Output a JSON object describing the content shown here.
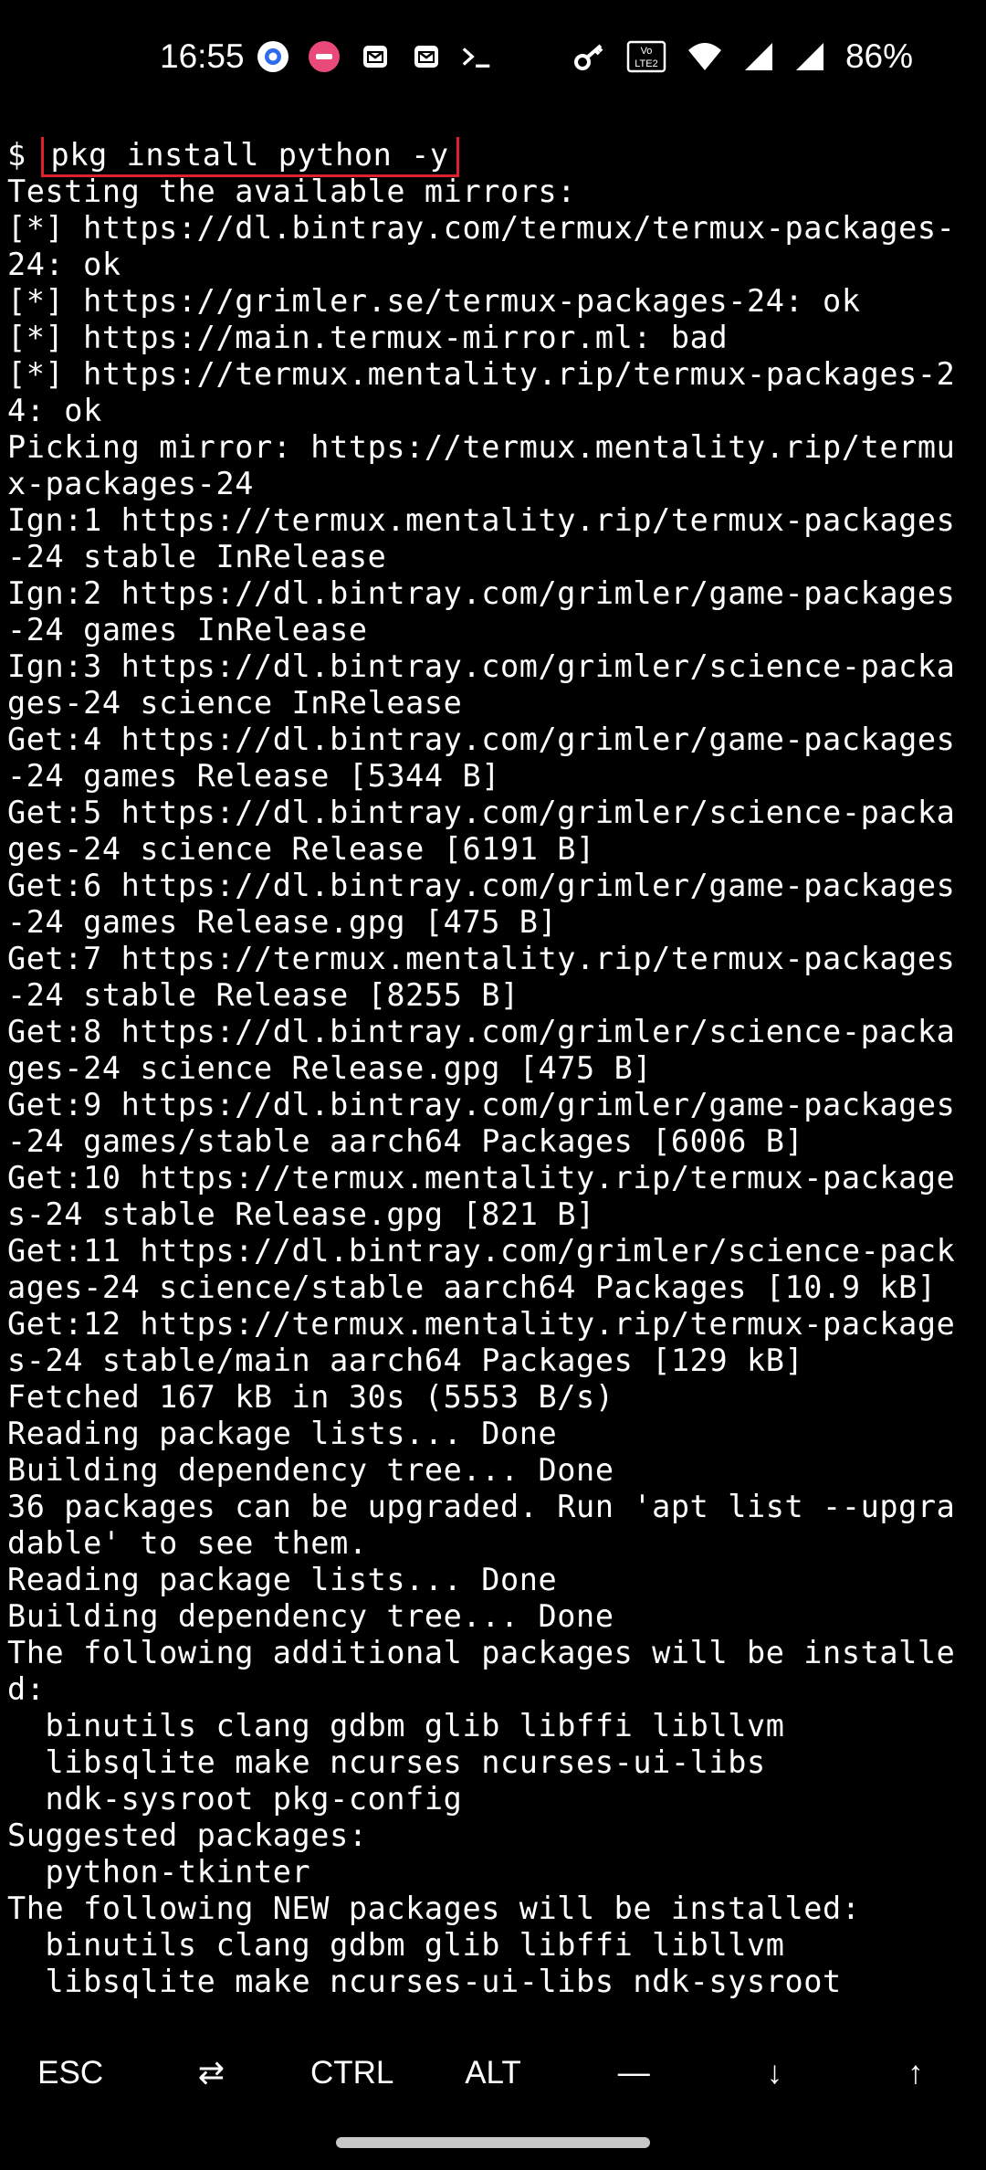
{
  "status_bar": {
    "time": "16:55",
    "battery": "86%",
    "notification_icons": [
      "signal-app-icon",
      "pink-app-icon",
      "mail-icon",
      "mail-icon",
      "terminal-icon"
    ],
    "system_icons": [
      "vpn-key-icon",
      "volte-icon",
      "wifi-icon",
      "cell-signal-icon",
      "cell-signal-icon"
    ],
    "volte_label": "Vo LTE2"
  },
  "terminal": {
    "prompt": "$ ",
    "command": "pkg install python -y",
    "lines": [
      "Testing the available mirrors:",
      "[*] https://dl.bintray.com/termux/termux-packages-",
      "24: ok",
      "[*] https://grimler.se/termux-packages-24: ok",
      "[*] https://main.termux-mirror.ml: bad",
      "[*] https://termux.mentality.rip/termux-packages-2",
      "4: ok",
      "Picking mirror: https://termux.mentality.rip/termu",
      "x-packages-24",
      "Ign:1 https://termux.mentality.rip/termux-packages",
      "-24 stable InRelease",
      "Ign:2 https://dl.bintray.com/grimler/game-packages",
      "-24 games InRelease",
      "Ign:3 https://dl.bintray.com/grimler/science-packa",
      "ges-24 science InRelease",
      "Get:4 https://dl.bintray.com/grimler/game-packages",
      "-24 games Release [5344 B]",
      "Get:5 https://dl.bintray.com/grimler/science-packa",
      "ges-24 science Release [6191 B]",
      "Get:6 https://dl.bintray.com/grimler/game-packages",
      "-24 games Release.gpg [475 B]",
      "Get:7 https://termux.mentality.rip/termux-packages",
      "-24 stable Release [8255 B]",
      "Get:8 https://dl.bintray.com/grimler/science-packa",
      "ges-24 science Release.gpg [475 B]",
      "Get:9 https://dl.bintray.com/grimler/game-packages",
      "-24 games/stable aarch64 Packages [6006 B]",
      "Get:10 https://termux.mentality.rip/termux-package",
      "s-24 stable Release.gpg [821 B]",
      "Get:11 https://dl.bintray.com/grimler/science-pack",
      "ages-24 science/stable aarch64 Packages [10.9 kB]",
      "Get:12 https://termux.mentality.rip/termux-package",
      "s-24 stable/main aarch64 Packages [129 kB]",
      "Fetched 167 kB in 30s (5553 B/s)",
      "Reading package lists... Done",
      "Building dependency tree... Done",
      "36 packages can be upgraded. Run 'apt list --upgra",
      "dable' to see them.",
      "Reading package lists... Done",
      "Building dependency tree... Done",
      "The following additional packages will be installe",
      "d:",
      "  binutils clang gdbm glib libffi libllvm",
      "  libsqlite make ncurses ncurses-ui-libs",
      "  ndk-sysroot pkg-config",
      "Suggested packages:",
      "  python-tkinter",
      "The following NEW packages will be installed:",
      "  binutils clang gdbm glib libffi libllvm",
      "  libsqlite make ncurses-ui-libs ndk-sysroot"
    ]
  },
  "extra_keys": [
    {
      "name": "esc-key",
      "label": "ESC"
    },
    {
      "name": "tab-key",
      "label": "⇄",
      "icon": "tab-arrows-icon"
    },
    {
      "name": "ctrl-key",
      "label": "CTRL"
    },
    {
      "name": "alt-key",
      "label": "ALT"
    },
    {
      "name": "dash-key",
      "label": "—"
    },
    {
      "name": "down-arrow-key",
      "label": "↓",
      "icon": "arrow-down-icon"
    },
    {
      "name": "up-arrow-key",
      "label": "↑",
      "icon": "arrow-up-icon"
    }
  ],
  "colors": {
    "background": "#000000",
    "text": "#ffffff",
    "highlight_box": "#e0202a"
  }
}
